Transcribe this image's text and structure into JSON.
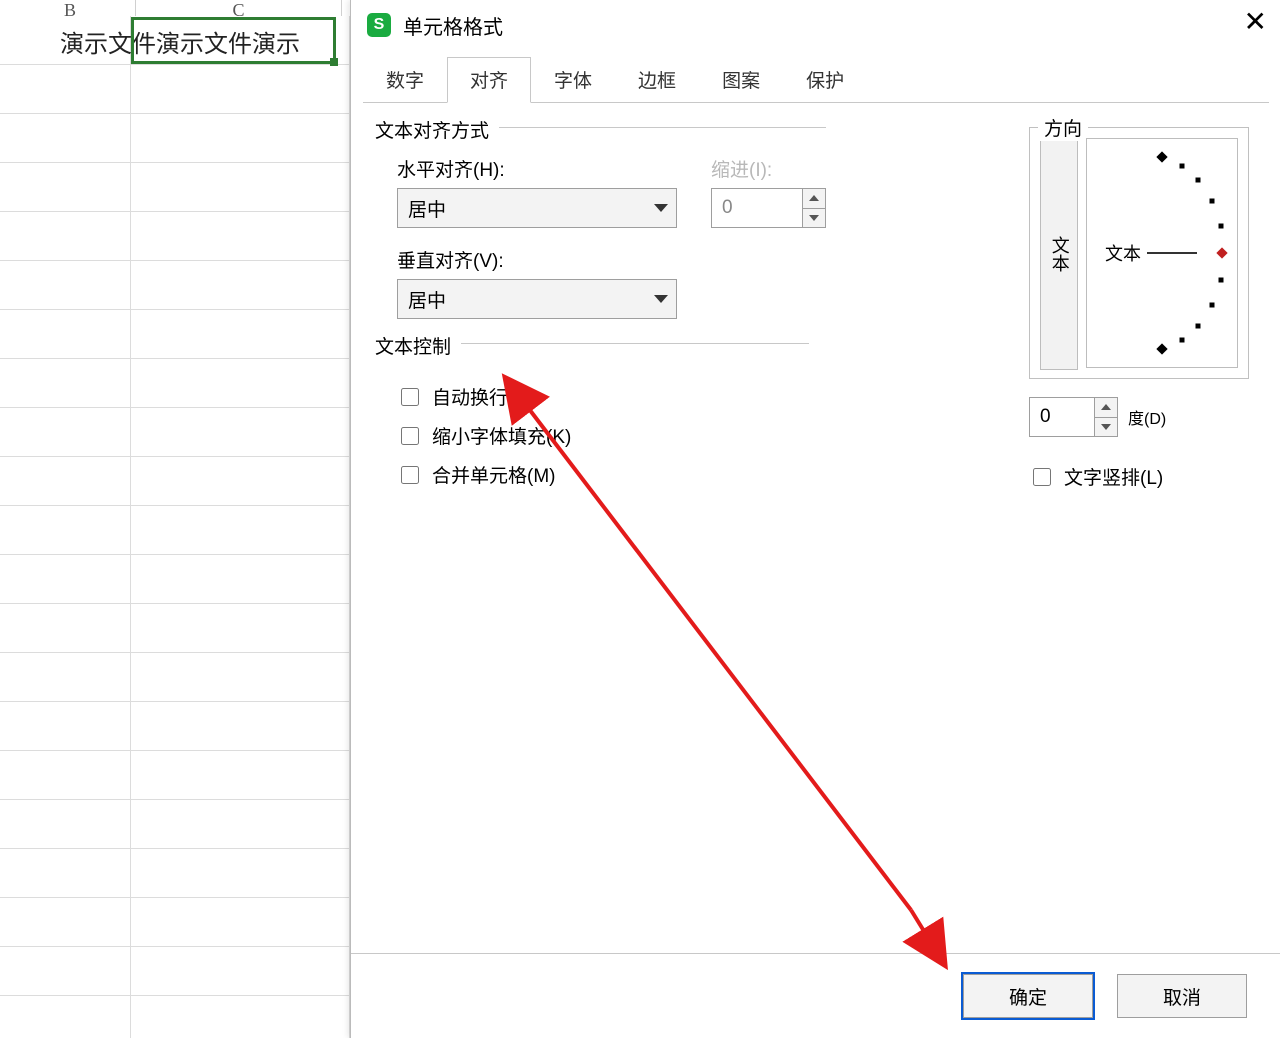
{
  "sheet": {
    "col_b": "B",
    "col_c": "C",
    "cell_text": "演示文件演示文件演示"
  },
  "dialog": {
    "title": "单元格格式",
    "tabs": [
      "数字",
      "对齐",
      "字体",
      "边框",
      "图案",
      "保护"
    ],
    "active_tab_index": 1,
    "align_group": {
      "legend": "文本对齐方式",
      "h_label": "水平对齐(H):",
      "h_value": "居中",
      "indent_label": "缩进(I):",
      "indent_value": "0",
      "v_label": "垂直对齐(V):",
      "v_value": "居中"
    },
    "control_group": {
      "legend": "文本控制",
      "wrap": "自动换行(W)",
      "shrink": "缩小字体填充(K)",
      "merge": "合并单元格(M)"
    },
    "orient": {
      "legend": "方向",
      "vertical_btn": "文本",
      "dial_label": "文本",
      "degree_value": "0",
      "degree_label": "度(D)",
      "vertical_text_chk": "文字竖排(L)"
    },
    "footer": {
      "ok": "确定",
      "cancel": "取消"
    }
  }
}
